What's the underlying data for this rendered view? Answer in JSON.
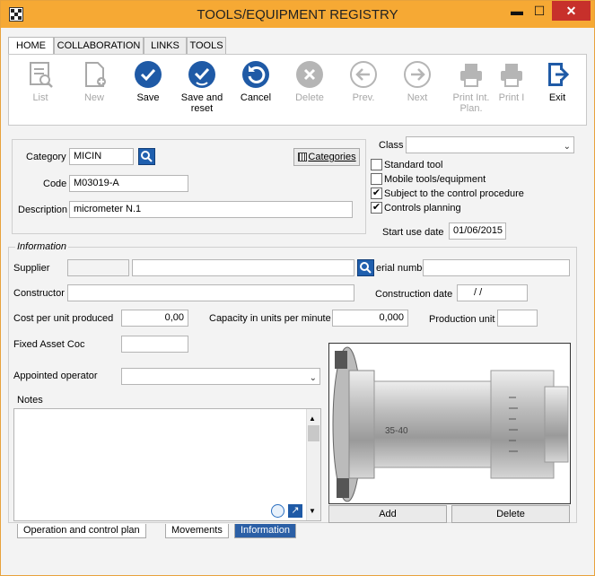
{
  "window": {
    "title": "TOOLS/EQUIPMENT REGISTRY",
    "minimize": "▬",
    "maximize": "☐",
    "close": "✕"
  },
  "tabs": [
    "HOME",
    "COLLABORATION",
    "LINKS",
    "TOOLS"
  ],
  "toolbar": {
    "list": "List",
    "new": "New",
    "save": "Save",
    "save_reset_1": "Save and",
    "save_reset_2": "reset",
    "cancel": "Cancel",
    "delete": "Delete",
    "prev": "Prev.",
    "next": "Next",
    "print_int_1": "Print Int.",
    "print_int_2": "Plan.",
    "print_2": "Print I",
    "exit": "Exit"
  },
  "form": {
    "category_label": "Category",
    "category_value": "MICIN",
    "code_label": "Code",
    "code_value": "M03019-A",
    "description_label": "Description",
    "description_value": "micrometer N.1",
    "categories_button": "Categories",
    "class_label": "Class",
    "class_value": "",
    "standard_tool": "Standard tool",
    "mobile_tools": "Mobile tools/equipment",
    "subject_control": "Subject to the control procedure",
    "controls_planning": "Controls planning",
    "checkmark": "✔",
    "start_use_label": "Start use date",
    "start_use_value": "01/06/2015"
  },
  "information": {
    "legend": "Information",
    "supplier_label": "Supplier",
    "serial_label": "erial numbe",
    "constructor_label": "Constructor",
    "construction_date_label": "Construction date",
    "construction_date_value": "/ /",
    "cost_label": "Cost per unit produced",
    "cost_value": "0,00",
    "capacity_label": "Capacity in units per minute",
    "capacity_value": "0,000",
    "production_unit_label": "Production unit",
    "fixed_asset_label": "Fixed Asset Coc",
    "operator_label": "Appointed operator",
    "notes_label": "Notes",
    "image_engraving": "35-40",
    "add_button": "Add",
    "delete_button": "Delete"
  },
  "bottom_tabs": [
    "Operation and control plan",
    "Movements",
    "Information"
  ]
}
